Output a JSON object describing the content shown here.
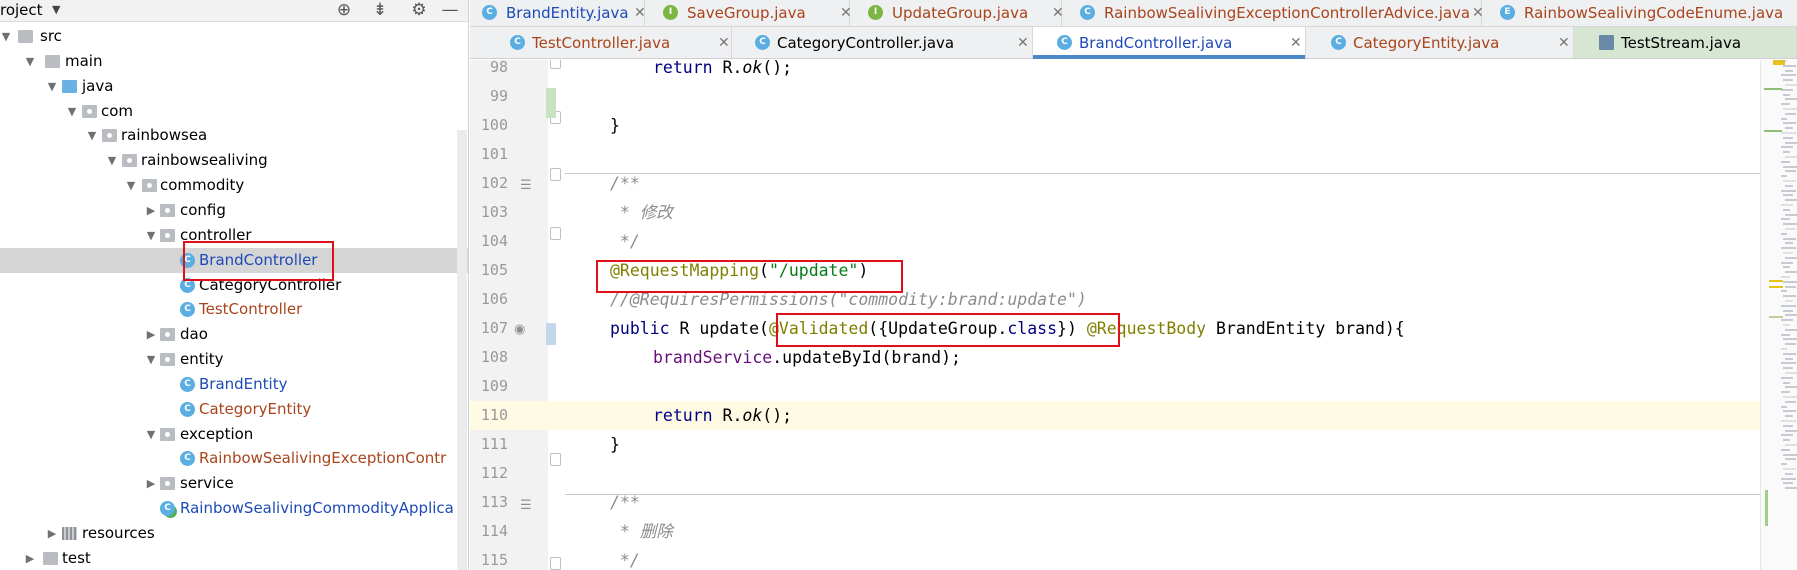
{
  "panel": {
    "title": "roject",
    "dropdown_icon": "triangle-down-icon",
    "header_icons": [
      "locate-icon",
      "collapse-icon",
      "gear-icon",
      "minimize-icon"
    ]
  },
  "tree": [
    {
      "label": "src",
      "type": "folder",
      "expanded": true
    },
    {
      "label": "main",
      "type": "folder",
      "expanded": true
    },
    {
      "label": "java",
      "type": "source-folder",
      "expanded": true
    },
    {
      "label": "com",
      "type": "package",
      "expanded": true
    },
    {
      "label": "rainbowsea",
      "type": "package",
      "expanded": true
    },
    {
      "label": "rainbowsealiving",
      "type": "package",
      "expanded": true
    },
    {
      "label": "commodity",
      "type": "package",
      "expanded": true
    },
    {
      "label": "config",
      "type": "package",
      "expanded": false
    },
    {
      "label": "controller",
      "type": "package",
      "expanded": true
    },
    {
      "label": "BrandController",
      "type": "class",
      "color": "selected",
      "selected": true
    },
    {
      "label": "CategoryController",
      "type": "class",
      "color": "default"
    },
    {
      "label": "TestController",
      "type": "class",
      "color": "red"
    },
    {
      "label": "dao",
      "type": "package",
      "expanded": false
    },
    {
      "label": "entity",
      "type": "package",
      "expanded": true
    },
    {
      "label": "BrandEntity",
      "type": "class",
      "color": "blue"
    },
    {
      "label": "CategoryEntity",
      "type": "class",
      "color": "red"
    },
    {
      "label": "exception",
      "type": "package",
      "expanded": true
    },
    {
      "label": "RainbowSealivingExceptionContr",
      "type": "class",
      "color": "red"
    },
    {
      "label": "service",
      "type": "package",
      "expanded": false
    },
    {
      "label": "RainbowSealivingCommodityApplica",
      "type": "app",
      "color": "blue"
    },
    {
      "label": "resources",
      "type": "resources",
      "expanded": false
    },
    {
      "label": "test",
      "type": "folder",
      "expanded": false
    }
  ],
  "tabs_row1": [
    {
      "label": "BrandEntity.java",
      "icon": "C",
      "color": "#1d4ab7"
    },
    {
      "label": "SaveGroup.java",
      "icon": "I",
      "color": "#a9441b"
    },
    {
      "label": "UpdateGroup.java",
      "icon": "I",
      "color": "#a9441b"
    },
    {
      "label": "RainbowSealivingExceptionControllerAdvice.java",
      "icon": "C",
      "color": "#a9441b"
    },
    {
      "label": "RainbowSealivingCodeEnume.java",
      "icon": "E",
      "color": "#a9441b"
    }
  ],
  "tabs_row2": [
    {
      "label": "TestController.java",
      "icon": "C",
      "color": "#a9441b"
    },
    {
      "label": "CategoryController.java",
      "icon": "C",
      "color": "#000000"
    },
    {
      "label": "BrandController.java",
      "icon": "C",
      "color": "#1d4ab7",
      "active": true
    },
    {
      "label": "CategoryEntity.java",
      "icon": "C",
      "color": "#a9441b"
    },
    {
      "label": "TestStream.java",
      "icon": "file",
      "color": "#000000"
    }
  ],
  "editor": {
    "lines": [
      {
        "num": "98",
        "tokens": [
          [
            "kw",
            "return "
          ],
          [
            "fn",
            "R."
          ],
          [
            "it",
            "ok"
          ],
          [
            "fn",
            "();"
          ]
        ],
        "indent": 2
      },
      {
        "num": "99",
        "tokens": [],
        "indent": 0
      },
      {
        "num": "100",
        "tokens": [
          [
            "fn",
            "}"
          ]
        ],
        "indent": 1
      },
      {
        "num": "101",
        "tokens": [],
        "indent": 0
      },
      {
        "num": "102",
        "tokens": [
          [
            "cmt",
            "/**"
          ]
        ],
        "indent": 1
      },
      {
        "num": "103",
        "tokens": [
          [
            "cmt",
            " * 修改"
          ]
        ],
        "indent": 1
      },
      {
        "num": "104",
        "tokens": [
          [
            "cmt",
            " */"
          ]
        ],
        "indent": 1
      },
      {
        "num": "105",
        "tokens": [
          [
            "ann",
            "@RequestMapping"
          ],
          [
            "fn",
            "("
          ],
          [
            "str",
            "\"/update\""
          ],
          [
            "fn",
            ")"
          ]
        ],
        "indent": 1
      },
      {
        "num": "106",
        "tokens": [
          [
            "cmt",
            "//@RequiresPermissions(\"commodity:brand:update\")"
          ]
        ],
        "indent": 1
      },
      {
        "num": "107",
        "tokens": [
          [
            "kw",
            "public "
          ],
          [
            "fn",
            "R update("
          ],
          [
            "ann",
            "@Validated"
          ],
          [
            "fn",
            "({UpdateGroup."
          ],
          [
            "kw",
            "class"
          ],
          [
            "fn",
            "}) "
          ],
          [
            "ann",
            "@RequestBody "
          ],
          [
            "fn",
            "BrandEntity brand){"
          ]
        ],
        "indent": 1
      },
      {
        "num": "108",
        "tokens": [
          [
            "fld",
            "brandService"
          ],
          [
            "fn",
            ".updateById(brand);"
          ]
        ],
        "indent": 2
      },
      {
        "num": "109",
        "tokens": [],
        "indent": 0
      },
      {
        "num": "110",
        "tokens": [
          [
            "kw",
            "return "
          ],
          [
            "fn",
            "R."
          ],
          [
            "it",
            "ok"
          ],
          [
            "fn",
            "();"
          ]
        ],
        "indent": 2,
        "current": true
      },
      {
        "num": "111",
        "tokens": [
          [
            "fn",
            "}"
          ]
        ],
        "indent": 1
      },
      {
        "num": "112",
        "tokens": [],
        "indent": 0
      },
      {
        "num": "113",
        "tokens": [
          [
            "cmt",
            "/**"
          ]
        ],
        "indent": 1
      },
      {
        "num": "114",
        "tokens": [
          [
            "cmt",
            " * 删除"
          ]
        ],
        "indent": 1
      },
      {
        "num": "115",
        "tokens": [
          [
            "cmt",
            " */"
          ]
        ],
        "indent": 1
      }
    ]
  },
  "colors": {
    "highlight_box": "#e0101a",
    "active_tab_underline": "#4a88c7",
    "annotation": "#808000",
    "keyword": "#000080",
    "string": "#067d17",
    "comment": "#8c8c8c"
  }
}
